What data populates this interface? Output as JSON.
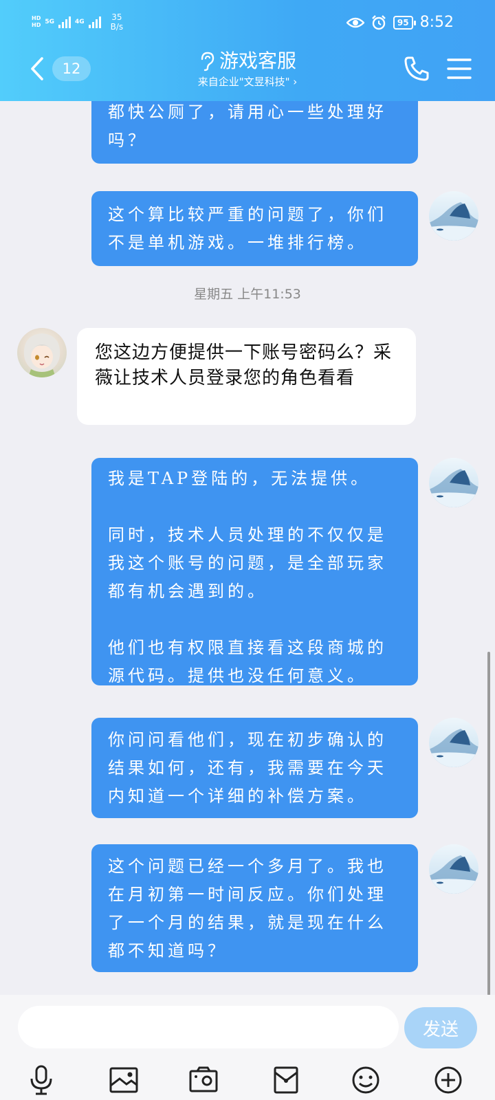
{
  "status_bar": {
    "hd1": "HD",
    "hd2": "HD",
    "net1": "5G",
    "net2": "4G",
    "speed_value": "35",
    "speed_unit": "B/s",
    "battery": "95",
    "time": "8:52"
  },
  "header": {
    "unread_count": "12",
    "title": "游戏客服",
    "subtitle": "来自企业\"文昱科技\" ›"
  },
  "messages": [
    {
      "from": "me",
      "text": "都快公厕了，请用心一些处理好吗？"
    },
    {
      "from": "me",
      "text": "这个算比较严重的问题了，你们不是单机游戏。一堆排行榜。"
    },
    {
      "type": "timestamp",
      "text": "星期五 上午11:53"
    },
    {
      "from": "agent",
      "text": "您这边方便提供一下账号密码么？采薇让技术人员登录您的角色看看"
    },
    {
      "from": "me",
      "text": "我是TAP登陆的，无法提供。\n\n同时，技术人员处理的不仅仅是我这个账号的问题，是全部玩家都有机会遇到的。\n\n他们也有权限直接看这段商城的源代码。提供也没任何意义。"
    },
    {
      "from": "me",
      "text": "你问问看他们，现在初步确认的结果如何，还有，我需要在今天内知道一个详细的补偿方案。"
    },
    {
      "from": "me",
      "text": "这个问题已经一个多月了。我也在月初第一时间反应。你们处理了一个月的结果，就是现在什么都不知道吗？"
    }
  ],
  "input": {
    "placeholder": "",
    "send_label": "发送"
  },
  "toolbar": [
    "mic-icon",
    "image-icon",
    "camera-icon",
    "red-packet-icon",
    "emoji-icon",
    "plus-icon"
  ],
  "colors": {
    "header_start": "#52cdfb",
    "header_end": "#41a2f5",
    "sent_bubble": "#3f94f1",
    "received_bubble": "#ffffff",
    "send_button": "#a9d4f8",
    "background": "#efeff4"
  }
}
